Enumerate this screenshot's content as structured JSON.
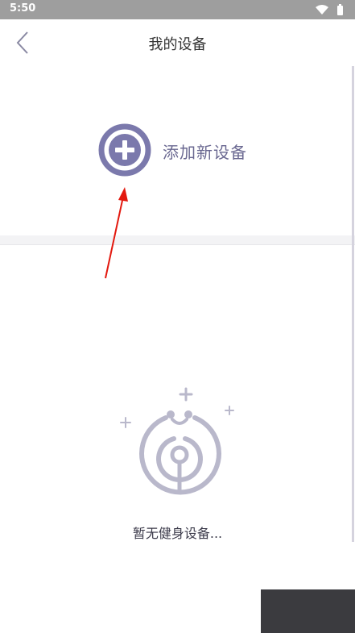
{
  "status_bar": {
    "time": "5:50",
    "icons": [
      "wifi-icon",
      "battery-icon"
    ]
  },
  "nav": {
    "title": "我的设备",
    "back_icon": "chevron-left-icon"
  },
  "add_device": {
    "label": "添加新设备",
    "icon": "plus-circle-icon",
    "color": "#7b79ac"
  },
  "empty_state": {
    "text": "暂无健身设备...",
    "icon": "device-signal-icon",
    "color": "#b9b8cb"
  },
  "colors": {
    "status_bar": "#9e9e9e",
    "annotation_arrow": "#e3190f"
  }
}
